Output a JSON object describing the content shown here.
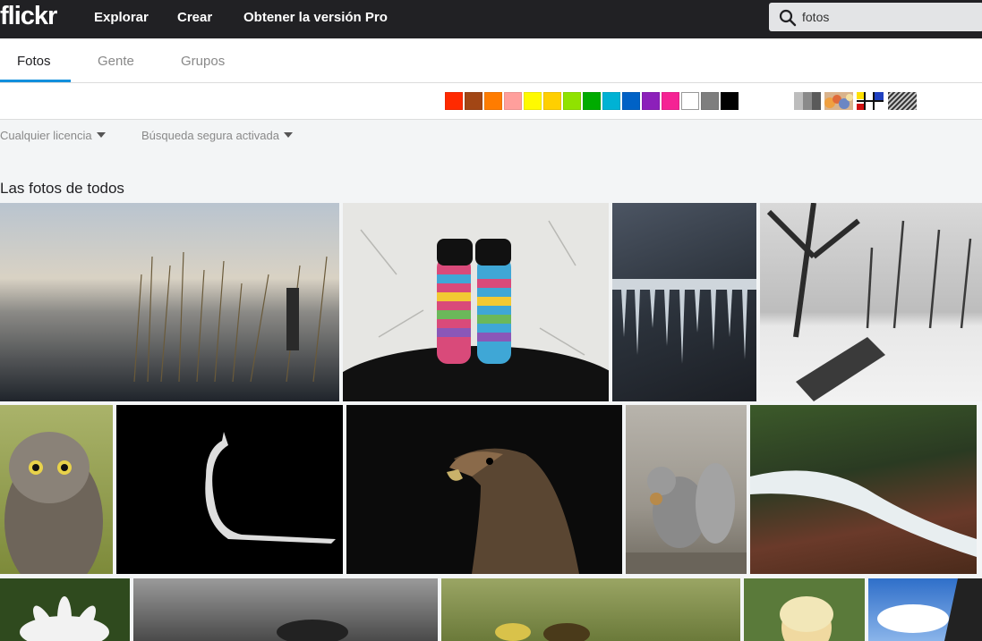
{
  "brand": {
    "logo": "flickr"
  },
  "nav": {
    "explore": "Explorar",
    "create": "Crear",
    "pro": "Obtener la versión Pro"
  },
  "search": {
    "value": "fotos"
  },
  "tabs": [
    {
      "label": "Fotos"
    },
    {
      "label": "Gente"
    },
    {
      "label": "Grupos"
    }
  ],
  "color_filters": [
    "#ff2a00",
    "#a24615",
    "#ff7c00",
    "#ff9f9c",
    "#fffa00",
    "#ffcf00",
    "#90e200",
    "#00ab00",
    "#00b2d4",
    "#0062c6",
    "#8c20ba",
    "#f52394",
    "#ffffff",
    "#7e7e7e",
    "#000000"
  ],
  "style_filters": [
    "black-and-white",
    "shallow-depth-of-field",
    "minimalism",
    "pattern"
  ],
  "filters": {
    "license": "Cualquier licencia",
    "safesearch": "Búsqueda segura activada"
  },
  "section": {
    "title": "Las fotos de todos"
  },
  "photos": [
    {
      "subject": "lake-reeds-sunrise"
    },
    {
      "subject": "striped-socks"
    },
    {
      "subject": "icicles"
    },
    {
      "subject": "snowy-trees"
    },
    {
      "subject": "owl"
    },
    {
      "subject": "cat-silhouette"
    },
    {
      "subject": "eagle"
    },
    {
      "subject": "squirrel"
    },
    {
      "subject": "waterfall"
    },
    {
      "subject": "white-flower"
    },
    {
      "subject": "cheetah"
    },
    {
      "subject": "bee"
    },
    {
      "subject": "woman-portrait"
    },
    {
      "subject": "sky-building"
    }
  ]
}
